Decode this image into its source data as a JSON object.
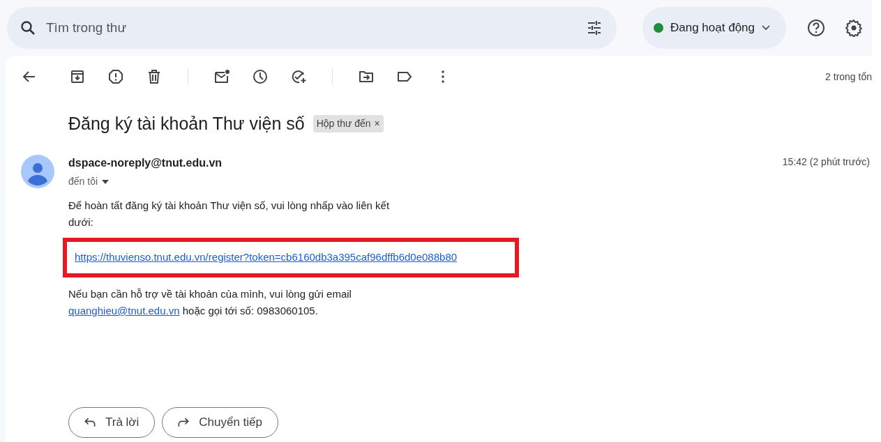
{
  "search": {
    "placeholder": "Tìm trong thư"
  },
  "status": {
    "label": "Đang hoạt động",
    "active": true
  },
  "pagination": "2 trong tổn",
  "subject": "Đăng ký tài khoản Thư viện số",
  "label_chip": {
    "text": "Hộp thư đến",
    "remove": "×"
  },
  "message": {
    "sender": "dspace-noreply@tnut.edu.vn",
    "recipient": "đến tôi",
    "time": "15:42 (2 phút trước)",
    "body": [
      {
        "kind": "text",
        "text": "Để hoàn tất đăng ký tài khoản Thư viện số, vui lòng nhấp vào liên kết dưới:"
      },
      {
        "kind": "link",
        "text": "https://thuvienso.tnut.edu.vn/register?token=cb6160db3a395caf96dffb6d0e088b80",
        "highlighted": true
      },
      {
        "kind": "mixed",
        "before": "Nếu bạn cần hỗ trợ về tài khoản của mình, vui lòng gửi email ",
        "link": "quanghieu@tnut.edu.vn",
        "after": " hoặc gọi tới số: 0983060105."
      }
    ]
  },
  "actions": [
    {
      "kind": "reply",
      "label": "Trả lời"
    },
    {
      "kind": "forward",
      "label": "Chuyển tiếp"
    }
  ]
}
